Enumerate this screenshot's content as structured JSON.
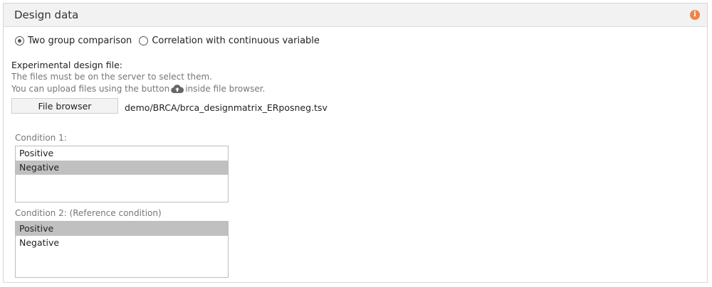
{
  "panel": {
    "title": "Design data",
    "info_icon": "info-icon"
  },
  "comparison": {
    "options": [
      {
        "label": "Two group comparison",
        "checked": true
      },
      {
        "label": "Correlation with continuous variable",
        "checked": false
      }
    ]
  },
  "design_file": {
    "label": "Experimental design file:",
    "help_line1": "The files must be on the server to select them.",
    "help_line2_before": "You can upload files using the button",
    "help_line2_icon": "cloud-upload-icon",
    "help_line2_after": "inside file browser.",
    "button_label": "File browser",
    "selected_path": "demo/BRCA/brca_designmatrix_ERposneg.tsv"
  },
  "condition1": {
    "label": "Condition 1:",
    "options": [
      "Positive",
      "Negative"
    ],
    "selected": "Negative"
  },
  "condition2": {
    "label": "Condition 2: (Reference condition)",
    "options": [
      "Positive",
      "Negative"
    ],
    "selected": "Positive"
  },
  "colors": {
    "info": "#f0834a",
    "selected_row": "#c0c0c0",
    "header_bg": "#f2f2f2"
  }
}
